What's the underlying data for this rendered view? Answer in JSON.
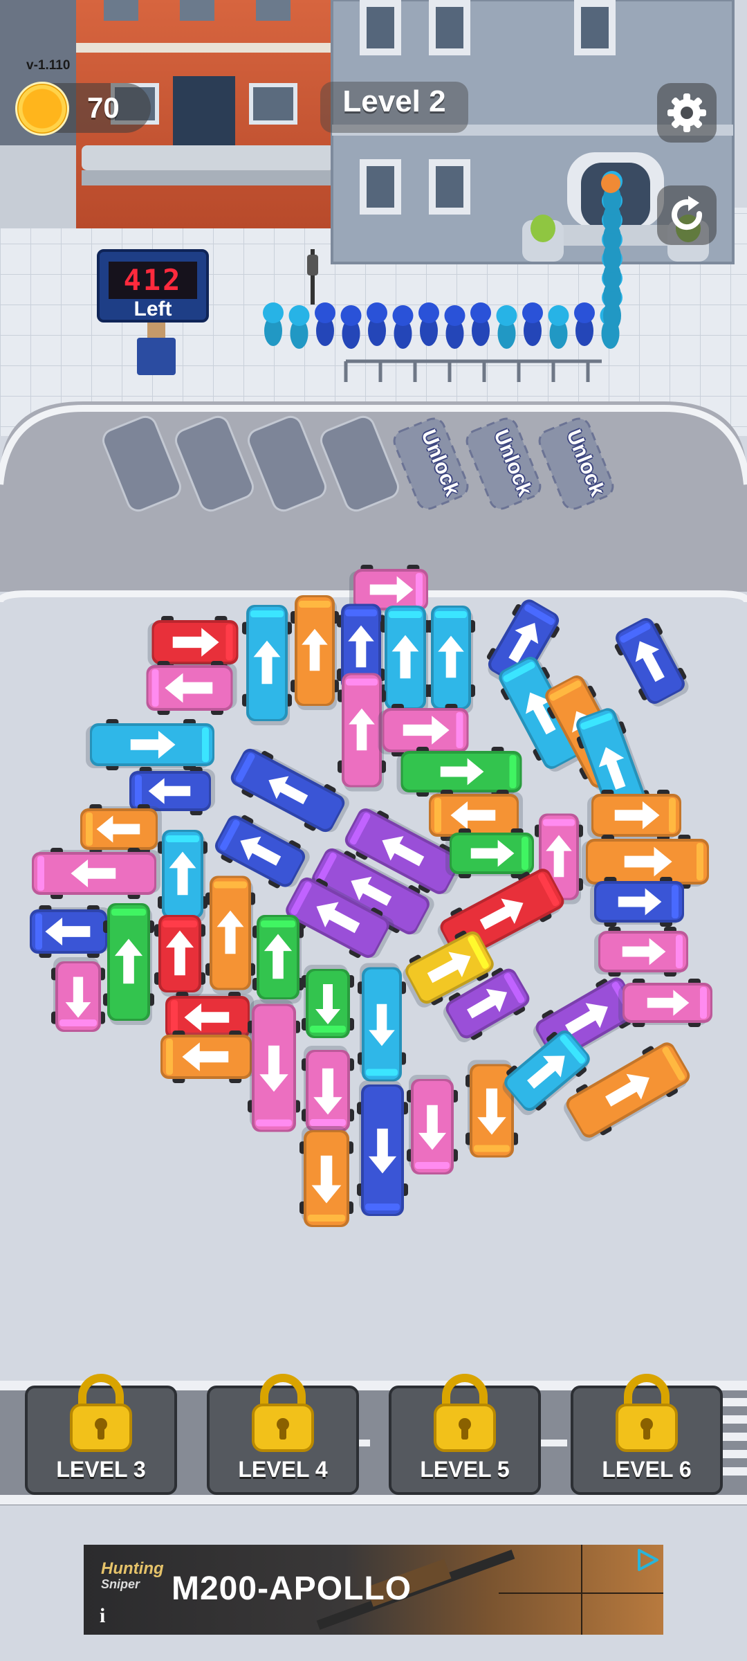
{
  "hud": {
    "version": "v-1.110",
    "coins": "70",
    "level_title": "Level 2"
  },
  "counter": {
    "value": "412",
    "label": "Left"
  },
  "parking": {
    "locked_slots": [
      {
        "label": "Unlock"
      },
      {
        "label": "Unlock"
      },
      {
        "label": "Unlock"
      }
    ]
  },
  "level_cards": [
    {
      "label": "LEVEL 3"
    },
    {
      "label": "LEVEL 4"
    },
    {
      "label": "LEVEL 5"
    },
    {
      "label": "LEVEL 6"
    }
  ],
  "ad": {
    "brand_line1": "Hunting",
    "brand_line2": "Sniper",
    "headline": "M200-APOLLO",
    "info_icon": "i"
  },
  "colors": {
    "red": "#e8303a",
    "pink": "#ec6fc0",
    "cyan": "#2fb7e8",
    "blue": "#3a55d6",
    "orange": "#f59334",
    "green": "#33c44e",
    "purple": "#9a4fd8",
    "yellow": "#f2c724"
  },
  "vehicles": [
    {
      "c": "pink",
      "dir": "right"
    },
    {
      "c": "red",
      "dir": "right"
    },
    {
      "c": "cyan",
      "dir": "up"
    },
    {
      "c": "orange",
      "dir": "up"
    },
    {
      "c": "blue",
      "dir": "up"
    },
    {
      "c": "cyan",
      "dir": "up"
    },
    {
      "c": "cyan",
      "dir": "up"
    },
    {
      "c": "blue",
      "dir": "up"
    },
    {
      "c": "blue",
      "dir": "up"
    },
    {
      "c": "pink",
      "dir": "left"
    },
    {
      "c": "cyan",
      "dir": "left"
    },
    {
      "c": "pink",
      "dir": "up"
    },
    {
      "c": "pink",
      "dir": "right"
    },
    {
      "c": "cyan",
      "dir": "right"
    },
    {
      "c": "orange",
      "dir": "right"
    },
    {
      "c": "blue",
      "dir": "left"
    },
    {
      "c": "blue",
      "dir": "up"
    },
    {
      "c": "green",
      "dir": "right"
    },
    {
      "c": "cyan",
      "dir": "right"
    },
    {
      "c": "orange",
      "dir": "left"
    },
    {
      "c": "purple",
      "dir": "up"
    },
    {
      "c": "orange",
      "dir": "left"
    },
    {
      "c": "blue",
      "dir": "up"
    },
    {
      "c": "pink",
      "dir": "up"
    },
    {
      "c": "orange",
      "dir": "right"
    },
    {
      "c": "green",
      "dir": "right"
    },
    {
      "c": "orange",
      "dir": "right"
    },
    {
      "c": "pink",
      "dir": "left"
    },
    {
      "c": "cyan",
      "dir": "up"
    },
    {
      "c": "purple",
      "dir": "up"
    },
    {
      "c": "red",
      "dir": "right"
    },
    {
      "c": "blue",
      "dir": "right"
    },
    {
      "c": "blue",
      "dir": "left"
    },
    {
      "c": "green",
      "dir": "up"
    },
    {
      "c": "orange",
      "dir": "up"
    },
    {
      "c": "purple",
      "dir": "up"
    },
    {
      "c": "pink",
      "dir": "right"
    },
    {
      "c": "red",
      "dir": "up"
    },
    {
      "c": "green",
      "dir": "up"
    },
    {
      "c": "yellow",
      "dir": "up"
    },
    {
      "c": "pink",
      "dir": "down"
    },
    {
      "c": "green",
      "dir": "down"
    },
    {
      "c": "cyan",
      "dir": "down"
    },
    {
      "c": "purple",
      "dir": "up"
    },
    {
      "c": "purple",
      "dir": "right"
    },
    {
      "c": "pink",
      "dir": "right"
    },
    {
      "c": "red",
      "dir": "left"
    },
    {
      "c": "orange",
      "dir": "left"
    },
    {
      "c": "pink",
      "dir": "down"
    },
    {
      "c": "pink",
      "dir": "down"
    },
    {
      "c": "blue",
      "dir": "down"
    },
    {
      "c": "pink",
      "dir": "down"
    },
    {
      "c": "orange",
      "dir": "down"
    },
    {
      "c": "cyan",
      "dir": "right"
    },
    {
      "c": "orange",
      "dir": "up"
    },
    {
      "c": "orange",
      "dir": "down"
    }
  ]
}
